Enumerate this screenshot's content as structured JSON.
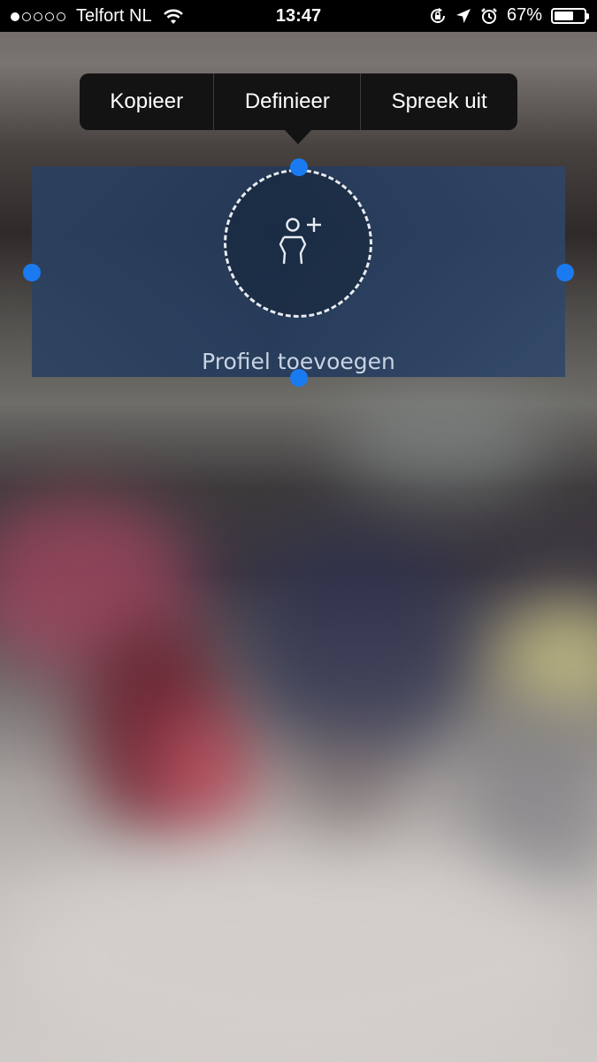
{
  "status_bar": {
    "carrier": "Telfort NL",
    "time": "13:47",
    "battery_percent": "67%",
    "battery_level": 0.67,
    "signal_bars_filled": 1,
    "signal_bars_total": 5,
    "icons": [
      "wifi-icon",
      "rotation-lock-icon",
      "location-arrow-icon",
      "alarm-icon",
      "battery-icon"
    ]
  },
  "edit_menu": {
    "items": [
      {
        "label": "Kopieer"
      },
      {
        "label": "Definieer"
      },
      {
        "label": "Spreek uit"
      }
    ]
  },
  "profile": {
    "add_label": "Profiel toevoegen",
    "icon": "person-plus-icon"
  },
  "colors": {
    "selection_handle": "#1a7af0",
    "menu_background": "#131313",
    "status_bar_background": "#000000"
  }
}
